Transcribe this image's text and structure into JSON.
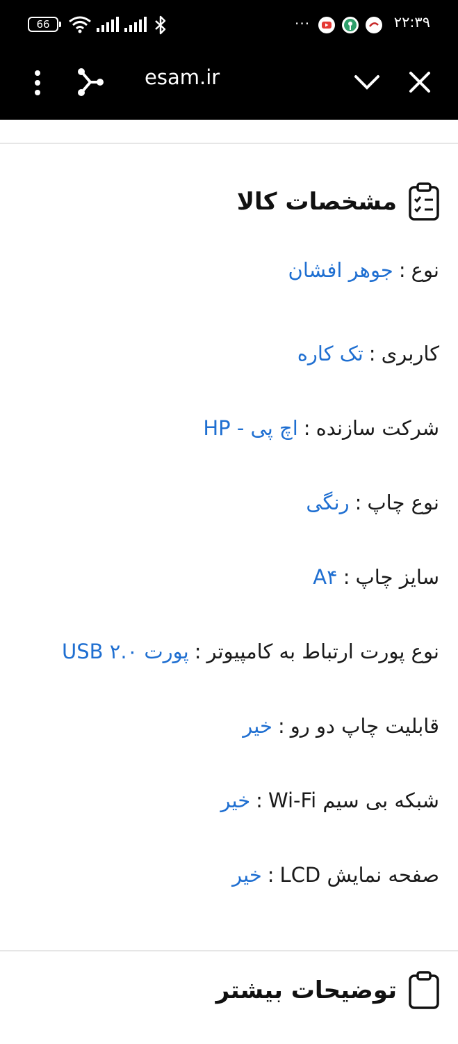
{
  "status_bar": {
    "battery": "66",
    "time": "۲۲:۳۹",
    "more": "···"
  },
  "browser": {
    "url": "esam.ir"
  },
  "specs_section": {
    "title": "مشخصات کالا",
    "items": [
      {
        "label": "نوع",
        "value": "جوهر افشان"
      },
      {
        "label": "کاربری",
        "value": "تک کاره"
      },
      {
        "label": "شرکت سازنده",
        "value": "اچ پی - HP"
      },
      {
        "label": "نوع چاپ",
        "value": "رنگی"
      },
      {
        "label": "سایز چاپ",
        "value": "A۴"
      },
      {
        "label": "نوع پورت ارتباط به کامپیوتر",
        "value": "پورت USB ۲.۰"
      },
      {
        "label": "قابلیت چاپ دو رو",
        "value": "خیر"
      },
      {
        "label": "شبکه بی سیم Wi-Fi",
        "value": "خیر"
      },
      {
        "label": "صفحه نمایش LCD",
        "value": "خیر"
      }
    ]
  },
  "more_section": {
    "title": "توضیحات بیشتر"
  },
  "colors": {
    "link_blue": "#1f6fd1",
    "topbar": "#000000"
  }
}
